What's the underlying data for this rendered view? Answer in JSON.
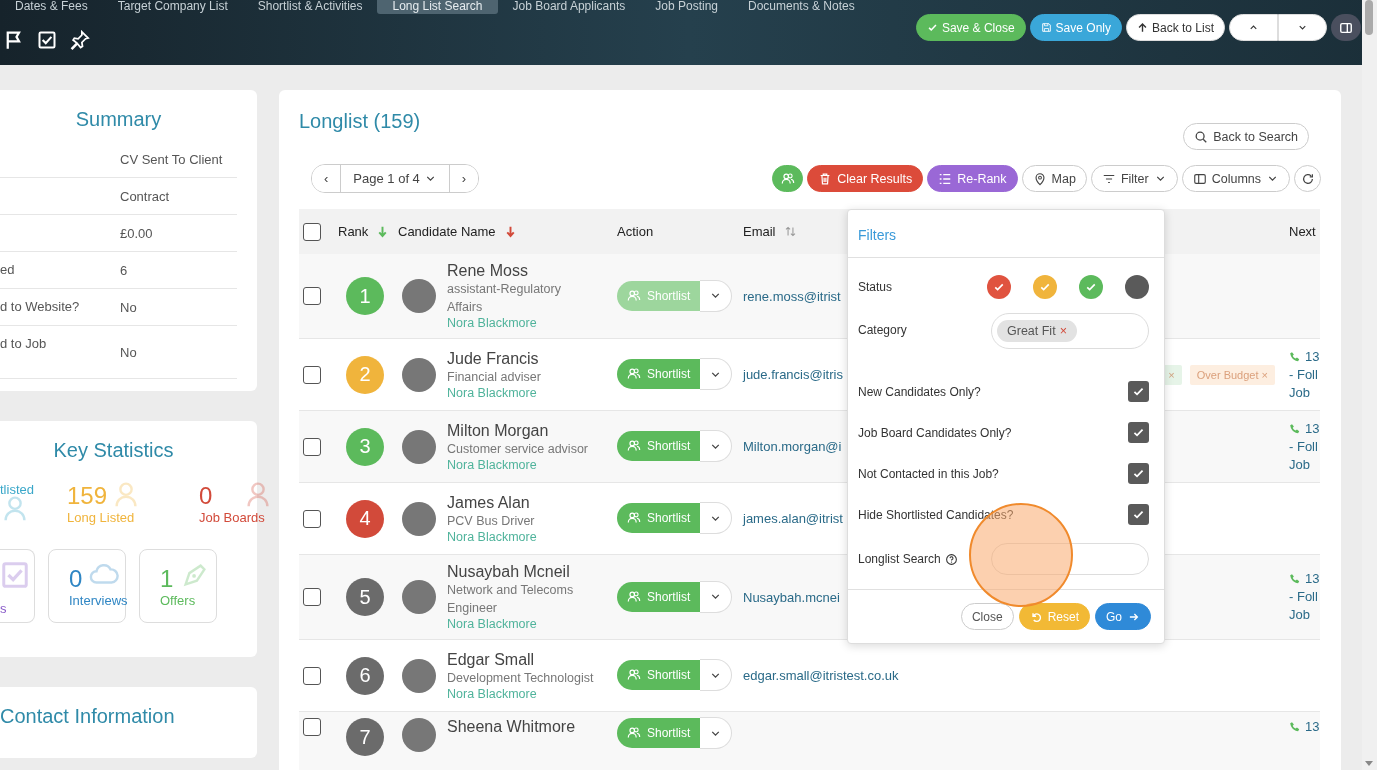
{
  "top_tabs": [
    {
      "label": "Dates & Fees",
      "selected": false
    },
    {
      "label": "Target Company List",
      "selected": false
    },
    {
      "label": "Shortlist & Activities",
      "selected": false
    },
    {
      "label": "Long List Search",
      "selected": true
    },
    {
      "label": "Job Board Applicants",
      "selected": false
    },
    {
      "label": "Job Posting",
      "selected": false
    },
    {
      "label": "Documents & Notes",
      "selected": false
    }
  ],
  "header_buttons": [
    {
      "kind": "save-close",
      "label": "Save & Close"
    },
    {
      "kind": "save",
      "label": "Save Only"
    },
    {
      "kind": "back",
      "label": "Back to List"
    }
  ],
  "summary": {
    "title": "Summary",
    "rows": [
      {
        "value": "CV Sent To Client"
      },
      {
        "value": "Contract"
      },
      {
        "value": "£0.00"
      },
      {
        "label": "ed",
        "value": "6"
      },
      {
        "label": "d to Website?",
        "value": "No"
      },
      {
        "label": "d to Job",
        "value": "No"
      }
    ]
  },
  "key_statistics": {
    "title": "Key Statistics",
    "items": [
      {
        "kind": "plain",
        "label": "tlisted",
        "color": "#3aa7c9"
      },
      {
        "kind": "plain",
        "value": "159",
        "label": "Long Listed",
        "color": "#f0b43c"
      },
      {
        "kind": "plain",
        "value": "0",
        "label": "Job Boards",
        "color": "#d24a3a"
      },
      {
        "kind": "boxed",
        "label": "s",
        "color": "#8a5cc9"
      },
      {
        "kind": "boxed",
        "value": "0",
        "label": "Interviews",
        "color": "#2f86c4"
      },
      {
        "kind": "boxed",
        "value": "1",
        "label": "Offers",
        "color": "#5cba5c"
      }
    ]
  },
  "contact_title": "Contact Information",
  "longlist": {
    "title": "Longlist (159)",
    "back_to_search": "Back to Search",
    "pagination": {
      "prev": "‹",
      "page": "Page 1 of 4",
      "next": "›"
    },
    "toolbar": [
      {
        "kind": "people"
      },
      {
        "kind": "clear",
        "label": "Clear Results"
      },
      {
        "kind": "rerank",
        "label": "Re-Rank"
      },
      {
        "kind": "map",
        "label": "Map"
      },
      {
        "kind": "filter",
        "label": "Filter"
      },
      {
        "kind": "columns",
        "label": "Columns"
      },
      {
        "kind": "refresh"
      }
    ],
    "select_all_checked": false,
    "columns": [
      {
        "label": "Rank",
        "kind": "ranked"
      },
      {
        "label": "Candidate Name",
        "kind": "sorted"
      },
      {
        "label": "Action",
        "kind": "plain"
      },
      {
        "label": "Email",
        "kind": "sortable"
      },
      {
        "label": "Next",
        "kind": "plain"
      }
    ],
    "rows": [
      {
        "checked": false,
        "rank": "1",
        "color": "#5cba5c",
        "name": "Rene Moss",
        "title": "assistant-Regulatory Affairs",
        "owner": "Nora Blackmore",
        "action": "Shortlist",
        "disabled": true,
        "email": "rene.moss@itrist"
      },
      {
        "checked": false,
        "rank": "2",
        "color": "#f0b43c",
        "name": "Jude Francis",
        "title": "Financial adviser",
        "owner": "Nora Blackmore",
        "action": "Shortlist",
        "disabled": false,
        "email": "jude.francis@itris",
        "tags": [
          {
            "close": "×",
            "color": "#e6f4e8"
          },
          {
            "label": "Over Budget",
            "close": "×",
            "color": "#fdeee0"
          }
        ],
        "next": [
          "13",
          "- Foll",
          "Job"
        ]
      },
      {
        "checked": false,
        "rank": "3",
        "color": "#5cba5c",
        "name": "Milton Morgan",
        "title": "Customer service advisor",
        "owner": "Nora Blackmore",
        "action": "Shortlist",
        "disabled": false,
        "email": "Milton.morgan@i",
        "next": [
          "13",
          "- Foll",
          "Job"
        ]
      },
      {
        "checked": false,
        "rank": "4",
        "color": "#d24a3a",
        "name": "James Alan",
        "title": "PCV Bus Driver",
        "owner": "Nora Blackmore",
        "action": "Shortlist",
        "disabled": false,
        "email": "james.alan@itrist"
      },
      {
        "checked": false,
        "rank": "5",
        "color": "#6b6b6b",
        "name": "Nusaybah Mcneil",
        "title": "Network and Telecoms Engineer",
        "owner": "Nora Blackmore",
        "action": "Shortlist",
        "disabled": false,
        "email": "Nusaybah.mcnei",
        "next": [
          "13",
          "- Foll",
          "Job"
        ]
      },
      {
        "checked": false,
        "rank": "6",
        "color": "#6b6b6b",
        "name": "Edgar Small",
        "title": "Development Technologist",
        "owner": "Nora Blackmore",
        "action": "Shortlist",
        "disabled": false,
        "email": "edgar.small@itristest.co.uk"
      },
      {
        "checked": false,
        "rank": "7",
        "color": "#6b6b6b",
        "name": "Sheena Whitmore",
        "action": "Shortlist",
        "disabled": false,
        "next": [
          "13"
        ]
      }
    ]
  },
  "filters": {
    "title": "Filters",
    "status_label": "Status",
    "status": [
      {
        "color": "#e0533f",
        "checked": true
      },
      {
        "color": "#f0b43c",
        "checked": true
      },
      {
        "color": "#5cba5c",
        "checked": true
      },
      {
        "color": "#5a5a5a",
        "checked": false
      }
    ],
    "category_label": "Category",
    "categories": [
      {
        "label": "Great Fit",
        "close": "×"
      }
    ],
    "options": [
      {
        "label": "New Candidates Only?",
        "checked": true
      },
      {
        "label": "Job Board Candidates Only?",
        "checked": true
      },
      {
        "label": "Not Contacted in this Job?",
        "checked": true
      },
      {
        "label": "Hide Shortlisted Candidates?",
        "checked": true
      }
    ],
    "search_label": "Longlist Search",
    "buttons": [
      {
        "kind": "close",
        "label": "Close"
      },
      {
        "kind": "reset",
        "label": "Reset"
      },
      {
        "kind": "go",
        "label": "Go"
      }
    ]
  }
}
